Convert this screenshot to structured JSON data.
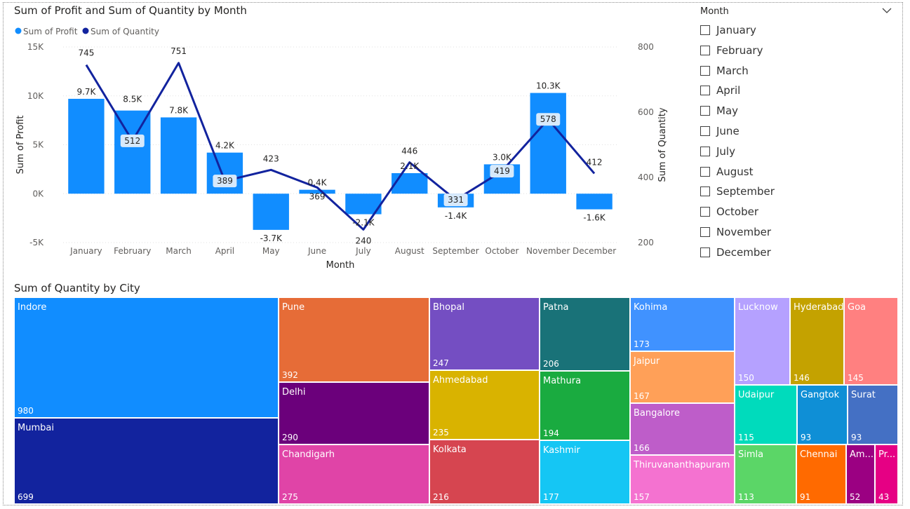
{
  "combo_title": "Sum of Profit and Sum of Quantity by Month",
  "treemap_title": "Sum of Quantity by City",
  "slicer": {
    "header": "Month",
    "options": [
      "January",
      "February",
      "March",
      "April",
      "May",
      "June",
      "July",
      "August",
      "September",
      "October",
      "November",
      "December"
    ]
  },
  "colors": {
    "bar": "#118DFF",
    "line": "#12239E",
    "text": "#252423",
    "axis": "#605E5C"
  },
  "chart_data": [
    {
      "type": "bar+line",
      "title": "Sum of Profit and Sum of Quantity by Month",
      "xlabel": "Month",
      "ylabel": "Sum of Profit",
      "y2label": "Sum of Quantity",
      "categories": [
        "January",
        "February",
        "March",
        "April",
        "May",
        "June",
        "July",
        "August",
        "September",
        "October",
        "November",
        "December"
      ],
      "series": [
        {
          "name": "Sum of Profit",
          "type": "bar",
          "axis": "left",
          "values": [
            9700,
            8500,
            7800,
            4200,
            -3700,
            400,
            -2100,
            2100,
            -1400,
            3000,
            10300,
            -1600
          ],
          "labels": [
            "9.7K",
            "8.5K",
            "7.8K",
            "4.2K",
            "-3.7K",
            "0.4K",
            "-2.1K",
            "2.1K",
            "-1.4K",
            "3.0K",
            "10.3K",
            "-1.6K"
          ]
        },
        {
          "name": "Sum of Quantity",
          "type": "line",
          "axis": "right",
          "values": [
            745,
            512,
            751,
            389,
            423,
            369,
            240,
            446,
            331,
            419,
            578,
            412
          ],
          "labels": [
            "745",
            "512",
            "751",
            "389",
            "423",
            "369",
            "240",
            "446",
            "331",
            "419",
            "578",
            "412"
          ]
        }
      ],
      "ylim": [
        -5000,
        15000
      ],
      "yticks": [
        "-5K",
        "0K",
        "5K",
        "10K",
        "15K"
      ],
      "y2lim": [
        200,
        800
      ],
      "y2ticks": [
        "200",
        "400",
        "600",
        "800"
      ],
      "legend": "top-left",
      "grid": true
    },
    {
      "type": "treemap",
      "title": "Sum of Quantity by City",
      "items": [
        {
          "name": "Indore",
          "value": 980,
          "color": "#118DFF"
        },
        {
          "name": "Mumbai",
          "value": 699,
          "color": "#12239E"
        },
        {
          "name": "Pune",
          "value": 392,
          "color": "#E66C37"
        },
        {
          "name": "Delhi",
          "value": 290,
          "color": "#6B007B"
        },
        {
          "name": "Chandigarh",
          "value": 275,
          "color": "#E044A7"
        },
        {
          "name": "Bhopal",
          "value": 247,
          "color": "#744EC2"
        },
        {
          "name": "Ahmedabad",
          "value": 235,
          "color": "#D9B300"
        },
        {
          "name": "Kolkata",
          "value": 216,
          "color": "#D64550"
        },
        {
          "name": "Patna",
          "value": 206,
          "color": "#197278"
        },
        {
          "name": "Mathura",
          "value": 194,
          "color": "#1AAB40"
        },
        {
          "name": "Kashmir",
          "value": 177,
          "color": "#15C6F4"
        },
        {
          "name": "Kohima",
          "value": 173,
          "color": "#4092FF"
        },
        {
          "name": "Jaipur",
          "value": 167,
          "color": "#FFA058"
        },
        {
          "name": "Bangalore",
          "value": 166,
          "color": "#BE5DC9"
        },
        {
          "name": "Thiruvananthapuram",
          "value": 157,
          "color": "#F472D0"
        },
        {
          "name": "Lucknow",
          "value": 150,
          "color": "#B5A1FF"
        },
        {
          "name": "Hyderabad",
          "value": 146,
          "color": "#C4A200"
        },
        {
          "name": "Goa",
          "value": 145,
          "color": "#FF8080"
        },
        {
          "name": "Udaipur",
          "value": 115,
          "color": "#00DBBC"
        },
        {
          "name": "Gangtok",
          "value": 93,
          "color": "#0F8FD6"
        },
        {
          "name": "Surat",
          "value": 93,
          "color": "#4470C4"
        },
        {
          "name": "Simla",
          "value": 113,
          "color": "#5BD667"
        },
        {
          "name": "Chennai",
          "value": 91,
          "color": "#FF6A00"
        },
        {
          "name": "Am...",
          "value": 52,
          "color": "#9B0082"
        },
        {
          "name": "Pr...",
          "value": 43,
          "color": "#E60084"
        }
      ]
    }
  ]
}
